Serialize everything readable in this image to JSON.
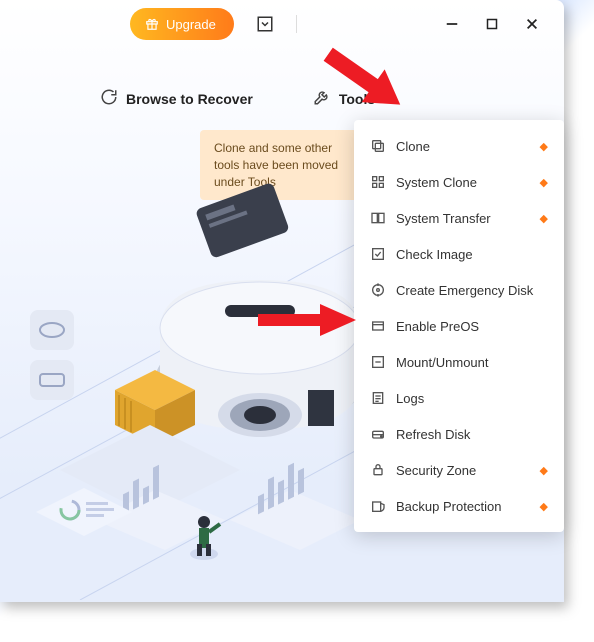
{
  "titlebar": {
    "upgrade_label": "Upgrade"
  },
  "toolbar": {
    "browse_label": "Browse to Recover",
    "tools_label": "Tools"
  },
  "notice": {
    "text": "Clone and some other tools have been moved under Tools"
  },
  "menu": {
    "items": [
      {
        "label": "Clone",
        "icon": "clone-icon",
        "premium": true
      },
      {
        "label": "System Clone",
        "icon": "system-clone-icon",
        "premium": true
      },
      {
        "label": "System Transfer",
        "icon": "system-transfer-icon",
        "premium": true
      },
      {
        "label": "Check Image",
        "icon": "check-image-icon",
        "premium": false
      },
      {
        "label": "Create Emergency Disk",
        "icon": "create-emergency-disk-icon",
        "premium": false
      },
      {
        "label": "Enable PreOS",
        "icon": "enable-preos-icon",
        "premium": false
      },
      {
        "label": "Mount/Unmount",
        "icon": "mount-unmount-icon",
        "premium": false
      },
      {
        "label": "Logs",
        "icon": "logs-icon",
        "premium": false
      },
      {
        "label": "Refresh Disk",
        "icon": "refresh-disk-icon",
        "premium": false
      },
      {
        "label": "Security Zone",
        "icon": "security-zone-icon",
        "premium": true
      },
      {
        "label": "Backup Protection",
        "icon": "backup-protection-icon",
        "premium": true
      }
    ]
  },
  "colors": {
    "accent": "#ff7a18",
    "arrow": "#ed1c24"
  }
}
